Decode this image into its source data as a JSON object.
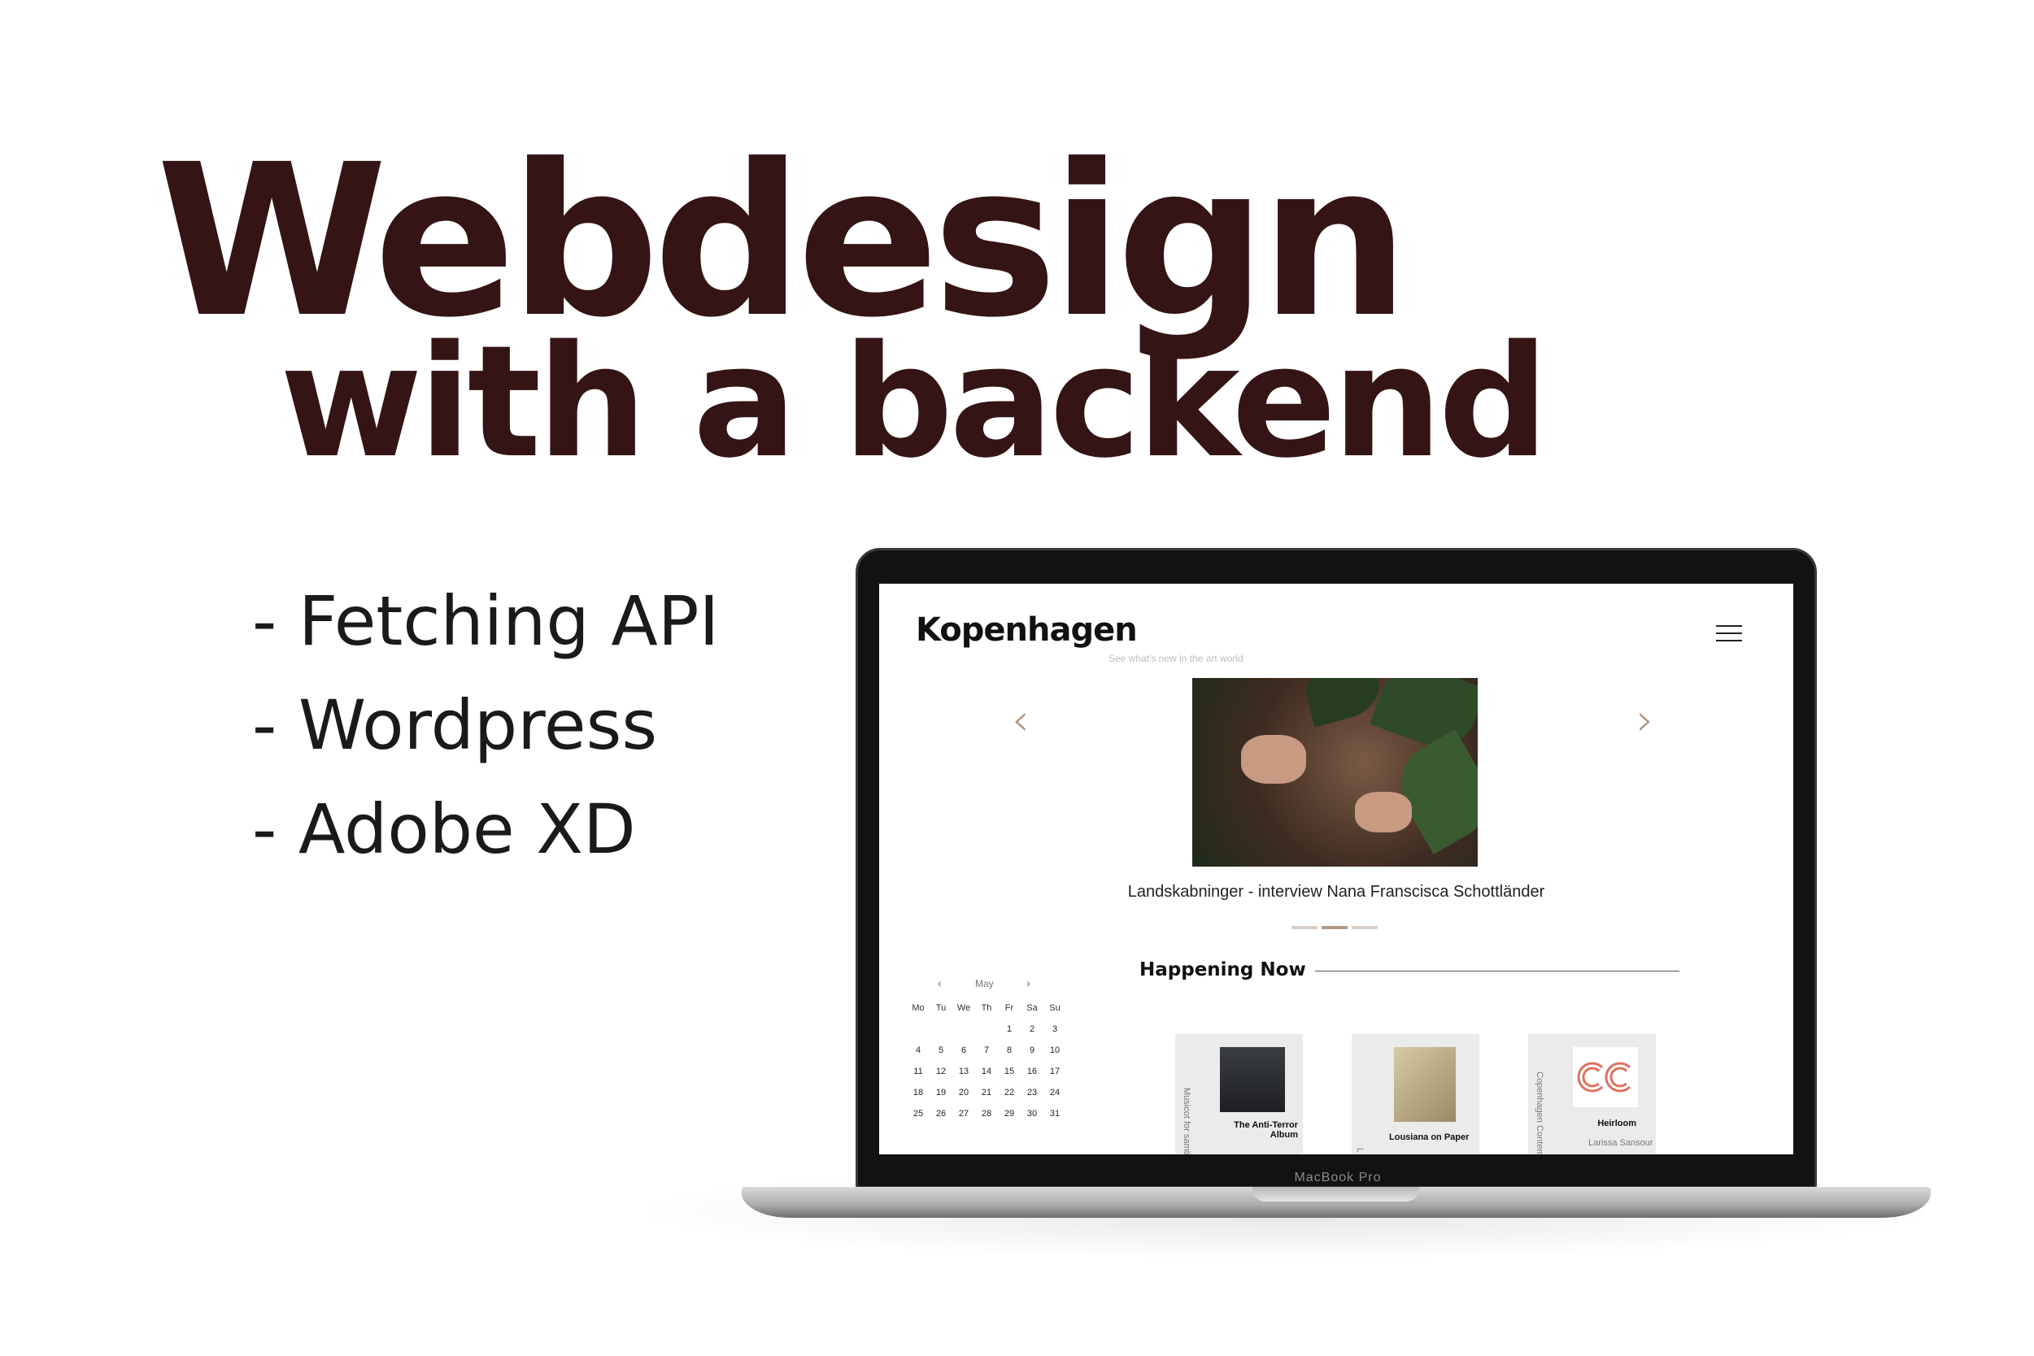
{
  "headline": {
    "line1": "Webdesign",
    "line2": "with a backend"
  },
  "features": [
    "- Fetching API",
    "- Wordpress",
    "- Adobe XD"
  ],
  "laptop": {
    "model_label": "MacBook Pro"
  },
  "site": {
    "logo": "Kopenhagen",
    "tagline": "See what's new in the art world",
    "menu_icon": "hamburger-menu-icon",
    "carousel": {
      "caption": "Landskabninger - interview Nana Franscisca Schottländer",
      "prev_icon": "chevron-left-icon",
      "next_icon": "chevron-right-icon",
      "prev_glyph": "‹",
      "next_glyph": "›",
      "slide_count": 3,
      "active_slide": 2
    },
    "section_title": "Happening Now",
    "calendar": {
      "month": "May",
      "prev": "‹",
      "next": "›",
      "weekdays": [
        "Mo",
        "Tu",
        "We",
        "Th",
        "Fr",
        "Sa",
        "Su"
      ],
      "weeks": [
        [
          "",
          "",
          "",
          "",
          "1",
          "2",
          "3"
        ],
        [
          "4",
          "5",
          "6",
          "7",
          "8",
          "9",
          "10"
        ],
        [
          "11",
          "12",
          "13",
          "14",
          "15",
          "16",
          "17"
        ],
        [
          "18",
          "19",
          "20",
          "21",
          "22",
          "23",
          "24"
        ],
        [
          "25",
          "26",
          "27",
          "28",
          "29",
          "30",
          "31"
        ]
      ]
    },
    "cards": [
      {
        "side_label": "Musicot for samtid",
        "title_line1": "The Anti-Terror",
        "title_line2": "Album",
        "subtitle": ""
      },
      {
        "side_label": "L",
        "title_line1": "Lousiana on Paper",
        "title_line2": "",
        "subtitle": ""
      },
      {
        "side_label": "Copenhagen Contem",
        "title_line1": "Heirloom",
        "title_line2": "",
        "subtitle": "Larissa Sansour"
      }
    ],
    "accent_color": "#b59a88",
    "heading_color": "#341414"
  }
}
